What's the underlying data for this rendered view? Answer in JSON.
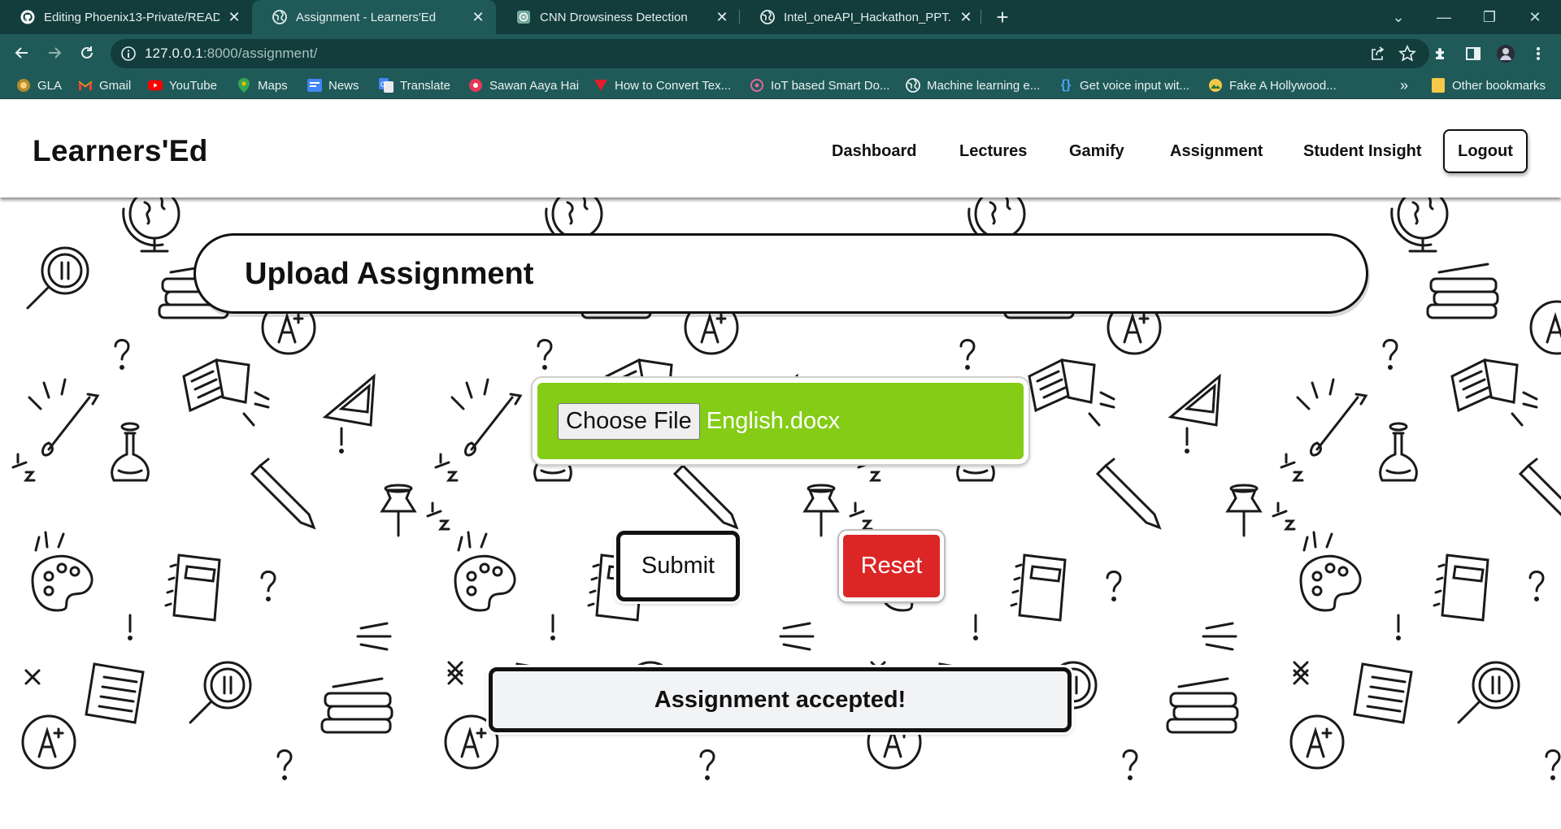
{
  "browser": {
    "tabs": [
      {
        "title": "Editing Phoenix13-Private/README.md",
        "icon": "github-icon",
        "active": false
      },
      {
        "title": "Assignment - Learners'Ed",
        "icon": "globe-icon",
        "active": true
      },
      {
        "title": "CNN Drowsiness Detection",
        "icon": "chatgpt-icon",
        "active": false
      },
      {
        "title": "Intel_oneAPI_Hackathon_PPT.png",
        "icon": "globe-icon",
        "active": false
      }
    ],
    "url_host": "127.0.0.1",
    "url_rest": ":8000/assignment/",
    "bookmarks": [
      {
        "label": "GLA",
        "icon": "gla-icon"
      },
      {
        "label": "Gmail",
        "icon": "gmail-icon"
      },
      {
        "label": "YouTube",
        "icon": "youtube-icon"
      },
      {
        "label": "Maps",
        "icon": "maps-icon"
      },
      {
        "label": "News",
        "icon": "news-icon"
      },
      {
        "label": "Translate",
        "icon": "translate-icon"
      },
      {
        "label": "Sawan Aaya Hai",
        "icon": "music-icon"
      },
      {
        "label": "How to Convert Tex...",
        "icon": "vercel-icon"
      },
      {
        "label": "IoT based Smart Do...",
        "icon": "iot-icon"
      },
      {
        "label": "Machine learning e...",
        "icon": "globe-icon"
      },
      {
        "label": "Get voice input wit...",
        "icon": "code-braces-icon"
      },
      {
        "label": "Fake A Hollywood...",
        "icon": "hollywood-icon"
      }
    ],
    "bookmarks_overflow": "»",
    "other_bookmarks": "Other bookmarks"
  },
  "site": {
    "brand": "Learners'Ed",
    "nav": [
      "Dashboard",
      "Lectures",
      "Gamify",
      "Assignment",
      "Student Insight"
    ],
    "logout": "Logout"
  },
  "upload": {
    "title": "Upload Assignment",
    "choose_file_label": "Choose File",
    "file_name": "English.docx",
    "submit_label": "Submit",
    "reset_label": "Reset",
    "status_message": "Assignment accepted!"
  },
  "colors": {
    "chrome_dark": "#123d3c",
    "chrome_mid": "#1f5a58",
    "upload_green": "#84cc16",
    "reset_red": "#dc2626"
  }
}
